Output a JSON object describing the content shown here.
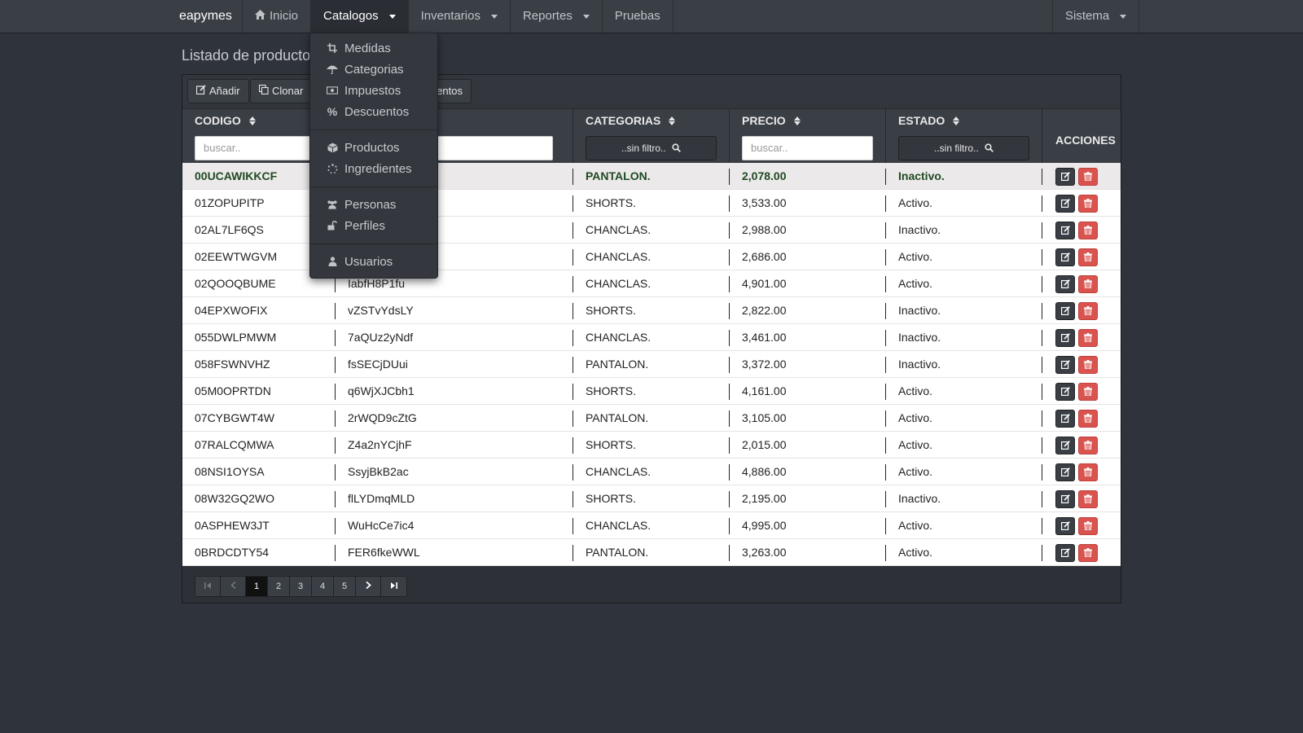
{
  "nav": {
    "brand": "eapymes",
    "items": [
      {
        "label": "Inicio",
        "icon": "home-icon"
      },
      {
        "label": "Catalogos",
        "dropdown": true,
        "active": true
      },
      {
        "label": "Inventarios",
        "dropdown": true
      },
      {
        "label": "Reportes",
        "dropdown": true
      },
      {
        "label": "Pruebas"
      }
    ],
    "right": {
      "label": "Sistema",
      "dropdown": true
    }
  },
  "page_title": "Listado de producto",
  "toolbar": {
    "add_label": "Añadir",
    "clone_label": "Clonar",
    "hidden_label": "entos"
  },
  "table": {
    "headers": {
      "codigo": "CODIGO",
      "categorias": "CATEGORIAS",
      "precio": "PRECIO",
      "estado": "ESTADO",
      "acciones": "ACCIONES"
    },
    "placeholders": {
      "codigo": "buscar..",
      "precio": "buscar.."
    },
    "filters": {
      "categorias": "..sin filtro..",
      "estado": "..sin filtro.."
    },
    "rows": [
      {
        "codigo": "00UCAWIKKCF",
        "nombre": "",
        "categoria": "PANTALON.",
        "precio": "2,078.00",
        "estado": "Inactivo."
      },
      {
        "codigo": "01ZOPUPITP",
        "nombre": "",
        "categoria": "SHORTS.",
        "precio": "3,533.00",
        "estado": "Activo."
      },
      {
        "codigo": "02AL7LF6QS",
        "nombre": "",
        "categoria": "CHANCLAS.",
        "precio": "2,988.00",
        "estado": "Inactivo."
      },
      {
        "codigo": "02EEWTWGVM",
        "nombre": "",
        "categoria": "CHANCLAS.",
        "precio": "2,686.00",
        "estado": "Activo."
      },
      {
        "codigo": "02QOOQBUME",
        "nombre": "IabfH8P1fu",
        "categoria": "CHANCLAS.",
        "precio": "4,901.00",
        "estado": "Activo."
      },
      {
        "codigo": "04EPXWOFIX",
        "nombre": "vZSTvYdsLY",
        "categoria": "SHORTS.",
        "precio": "2,822.00",
        "estado": "Inactivo."
      },
      {
        "codigo": "055DWLPMWM",
        "nombre": "7aQUz2yNdf",
        "categoria": "CHANCLAS.",
        "precio": "3,461.00",
        "estado": "Inactivo."
      },
      {
        "codigo": "058FSWNVHZ",
        "nombre": "fsSECjDUui",
        "categoria": "PANTALON.",
        "precio": "3,372.00",
        "estado": "Inactivo."
      },
      {
        "codigo": "05M0OPRTDN",
        "nombre": "q6WjXJCbh1",
        "categoria": "SHORTS.",
        "precio": "4,161.00",
        "estado": "Activo."
      },
      {
        "codigo": "07CYBGWT4W",
        "nombre": "2rWQD9cZtG",
        "categoria": "PANTALON.",
        "precio": "3,105.00",
        "estado": "Activo."
      },
      {
        "codigo": "07RALCQMWA",
        "nombre": "Z4a2nYCjhF",
        "categoria": "SHORTS.",
        "precio": "2,015.00",
        "estado": "Activo."
      },
      {
        "codigo": "08NSI1OYSA",
        "nombre": "SsyjBkB2ac",
        "categoria": "CHANCLAS.",
        "precio": "4,886.00",
        "estado": "Activo."
      },
      {
        "codigo": "08W32GQ2WO",
        "nombre": "flLYDmqMLD",
        "categoria": "SHORTS.",
        "precio": "2,195.00",
        "estado": "Inactivo."
      },
      {
        "codigo": "0ASPHEW3JT",
        "nombre": "WuHcCe7ic4",
        "categoria": "CHANCLAS.",
        "precio": "4,995.00",
        "estado": "Activo."
      },
      {
        "codigo": "0BRDCDTY54",
        "nombre": "FER6fkeWWL",
        "categoria": "PANTALON.",
        "precio": "3,263.00",
        "estado": "Activo."
      }
    ]
  },
  "pagination": {
    "pages": [
      "1",
      "2",
      "3",
      "4",
      "5"
    ],
    "current": "1"
  },
  "dropdown": {
    "groups": [
      [
        {
          "label": "Medidas",
          "icon": "crop-icon"
        },
        {
          "label": "Categorias",
          "icon": "umbrella-icon"
        },
        {
          "label": "Impuestos",
          "icon": "money-icon"
        },
        {
          "label": "Descuentos",
          "icon": "percent-icon"
        }
      ],
      [
        {
          "label": "Productos",
          "icon": "cube-icon"
        },
        {
          "label": "Ingredientes",
          "icon": "spinner-icon"
        }
      ],
      [
        {
          "label": "Personas",
          "icon": "users-icon"
        },
        {
          "label": "Perfiles",
          "icon": "unlock-icon"
        }
      ],
      [
        {
          "label": "Usuarios",
          "icon": "user-icon"
        }
      ]
    ]
  },
  "colors": {
    "navbar": "#3a3f46",
    "background": "#2f333b",
    "delete": "#d9534f",
    "highlight_text": "#1f4a22"
  }
}
